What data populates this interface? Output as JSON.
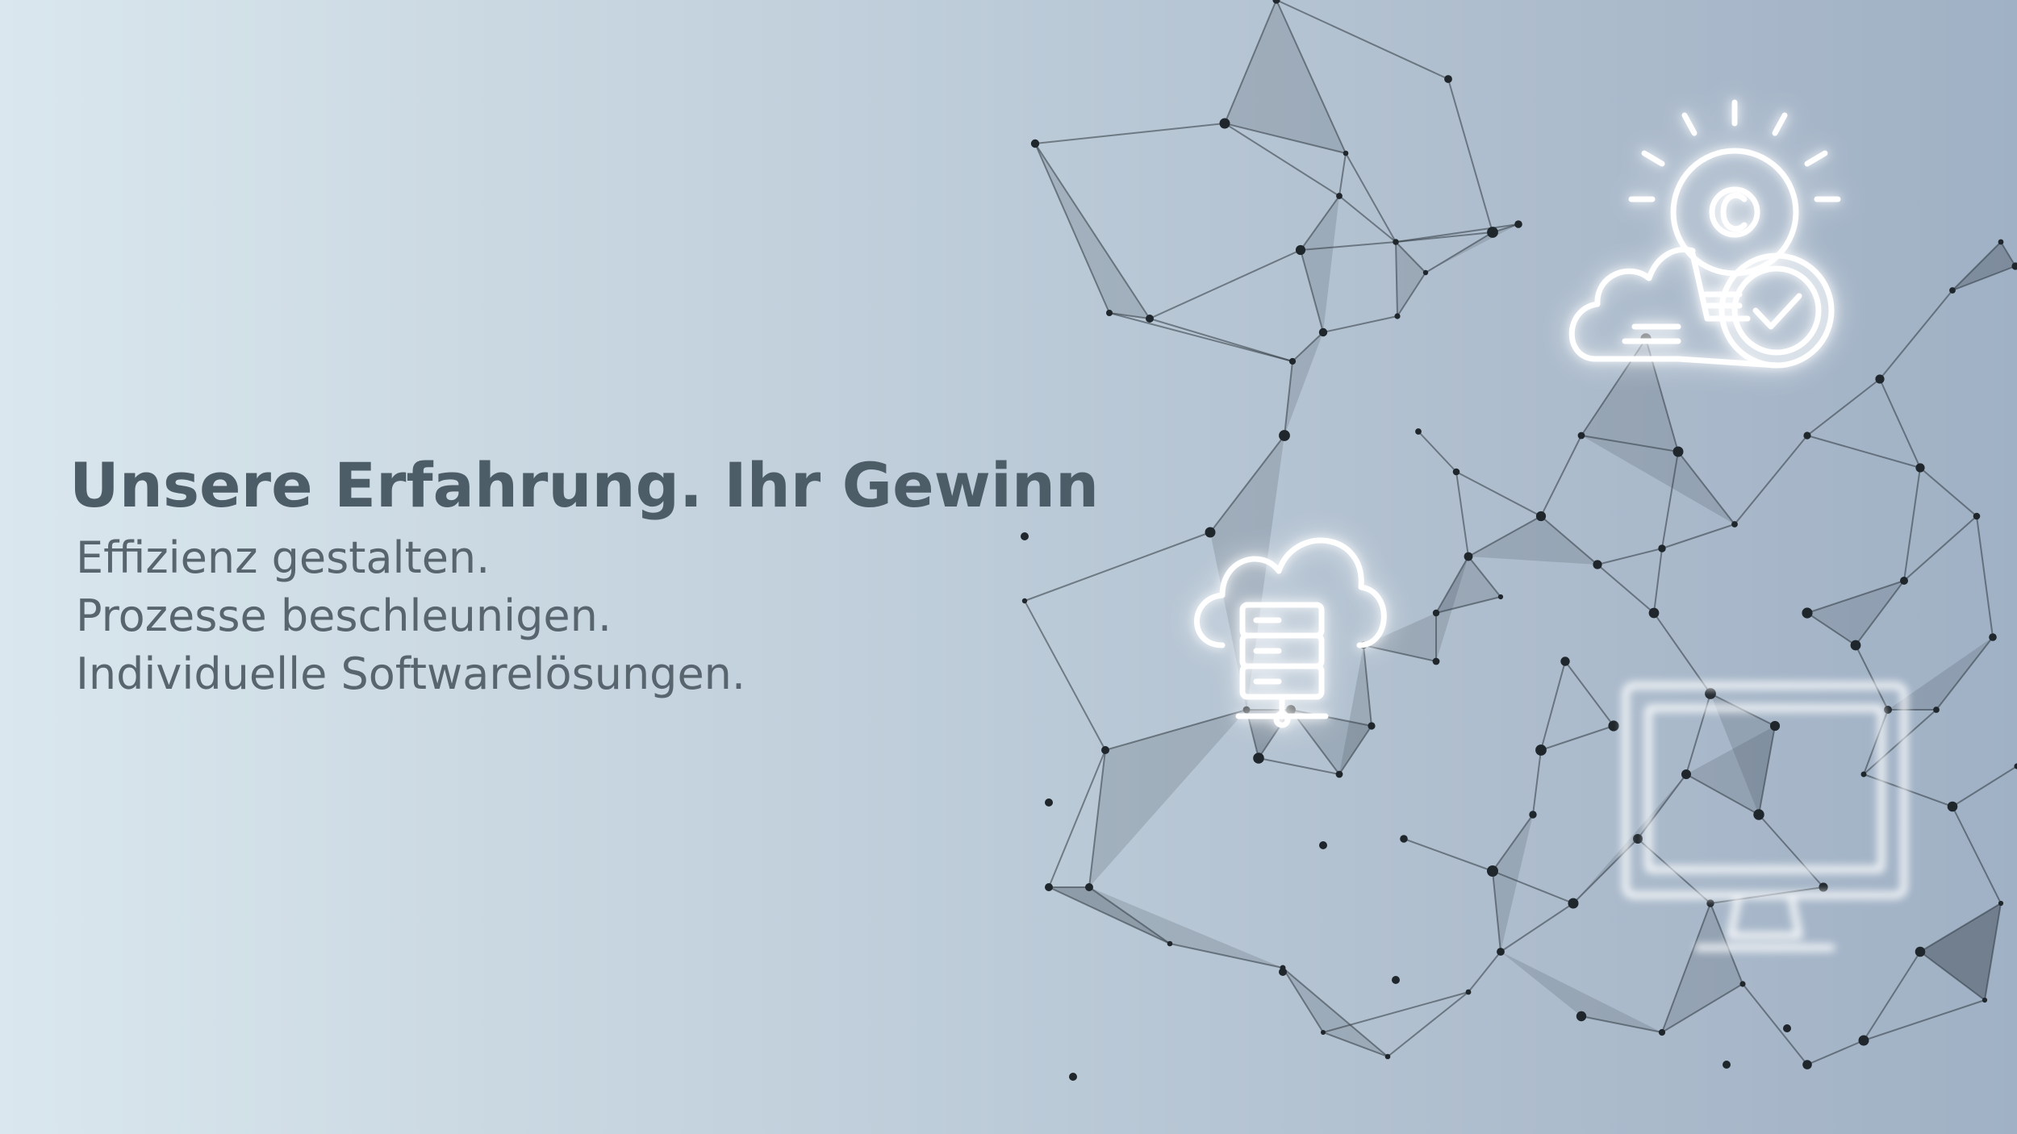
{
  "hero": {
    "headline": "Unsere Erfahrung. Ihr Gewinn",
    "taglines": [
      "Effizienz gestalten.",
      "Prozesse beschleunigen.",
      "Individuelle Softwarelösungen."
    ]
  },
  "icons": {
    "cloud_server": "cloud-server-icon",
    "bulb_cloud": "lightbulb-cloud-check-icon",
    "monitor": "monitor-icon"
  },
  "colors": {
    "headline": "#4d5d68",
    "tagline": "#58656f",
    "background_left": "#dae7ee",
    "background_right": "#a0b1c5",
    "icon_glow": "#ffffff",
    "network": "#2f3840"
  }
}
